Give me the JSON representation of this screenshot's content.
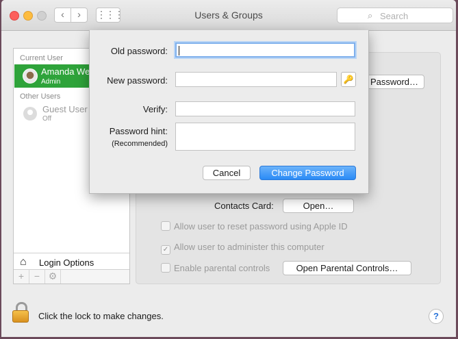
{
  "window": {
    "title": "Users & Groups"
  },
  "toolbar": {
    "back": "‹",
    "forward": "›",
    "grid": "⋮⋮⋮",
    "search_placeholder": "Search",
    "search_icon": "search-icon"
  },
  "sidebar": {
    "current_user_header": "Current User",
    "current_user": {
      "name": "Amanda Wei",
      "role": "Admin"
    },
    "other_users_header": "Other Users",
    "guest": {
      "name": "Guest User",
      "role": "Off"
    },
    "login_options": "Login Options",
    "tools": [
      "+",
      "−",
      "⚙"
    ]
  },
  "main": {
    "change_password_button": "Password…",
    "contacts_card_label": "Contacts Card:",
    "open_button": "Open…",
    "checkboxes": [
      {
        "label": "Allow user to reset password using Apple ID",
        "checked": false
      },
      {
        "label": "Allow user to administer this computer",
        "checked": true
      },
      {
        "label": "Enable parental controls",
        "checked": false
      }
    ],
    "parental_button": "Open Parental Controls…"
  },
  "footer": {
    "lock_text": "Click the lock to make changes.",
    "help": "?"
  },
  "sheet": {
    "old_password_label": "Old password:",
    "new_password_label": "New password:",
    "verify_label": "Verify:",
    "hint_label": "Password hint:",
    "hint_sub": "(Recommended)",
    "old_password_value": "",
    "new_password_value": "",
    "verify_value": "",
    "hint_value": "",
    "cancel": "Cancel",
    "change": "Change Password"
  },
  "colors": {
    "accent": "#2ea33a",
    "primary_button": "#2a8af6"
  }
}
